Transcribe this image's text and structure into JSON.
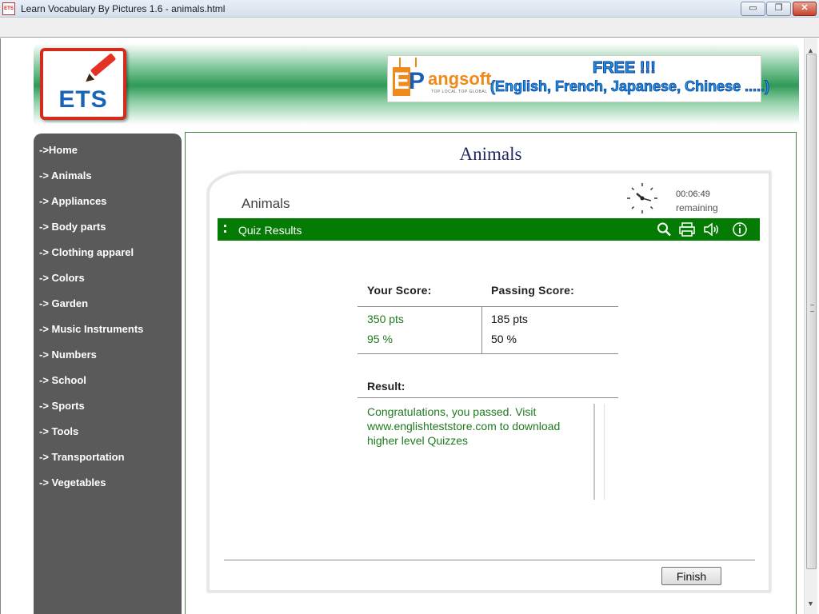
{
  "window": {
    "title": "Learn Vocabulary By Pictures 1.6 - animals.html",
    "app_icon_label": "ETS",
    "minimize_glyph": "▭",
    "maximize_glyph": "❐",
    "close_glyph": "✕"
  },
  "header": {
    "logo_text": "ETS",
    "banner": {
      "brand_e": "E",
      "brand_p": "P",
      "brand_rest": "angsoft",
      "tagline": "TOP LOCAL TOP GLOBAL",
      "free_text": "FREE !!!",
      "languages": "(English, French, Japanese, Chinese .....)"
    }
  },
  "sidebar": {
    "items": [
      {
        "label": "->Home"
      },
      {
        "label": "-> Animals"
      },
      {
        "label": "-> Appliances"
      },
      {
        "label": "-> Body parts"
      },
      {
        "label": "-> Clothing apparel"
      },
      {
        "label": "-> Colors"
      },
      {
        "label": "-> Garden"
      },
      {
        "label": "-> Music Instruments"
      },
      {
        "label": "-> Numbers"
      },
      {
        "label": "-> School"
      },
      {
        "label": "-> Sports"
      },
      {
        "label": "-> Tools"
      },
      {
        "label": "-> Transportation"
      },
      {
        "label": "-> Vegetables"
      }
    ]
  },
  "main": {
    "title": "Animals",
    "quiz": {
      "name": "Animals",
      "time_remaining": "00:06:49",
      "remaining_label": "remaining",
      "bar_title": "Quiz Results",
      "icons": [
        "search-icon",
        "print-icon",
        "sound-icon",
        "info-icon"
      ],
      "your_score_label": "Your Score:",
      "passing_score_label": "Passing Score:",
      "your_points": "350 pts",
      "your_percent": "95 %",
      "passing_points": "185 pts",
      "passing_percent": "50 %",
      "result_label": "Result:",
      "result_message": "Congratulations, you passed. Visit www.englishteststore.com to download higher level Quizzes",
      "finish_label": "Finish"
    }
  },
  "colors": {
    "sidebar_bg": "#5a5a5a",
    "quiz_bar": "#047c04",
    "score_green": "#1f7a1f",
    "title_navy": "#1f2a66"
  }
}
